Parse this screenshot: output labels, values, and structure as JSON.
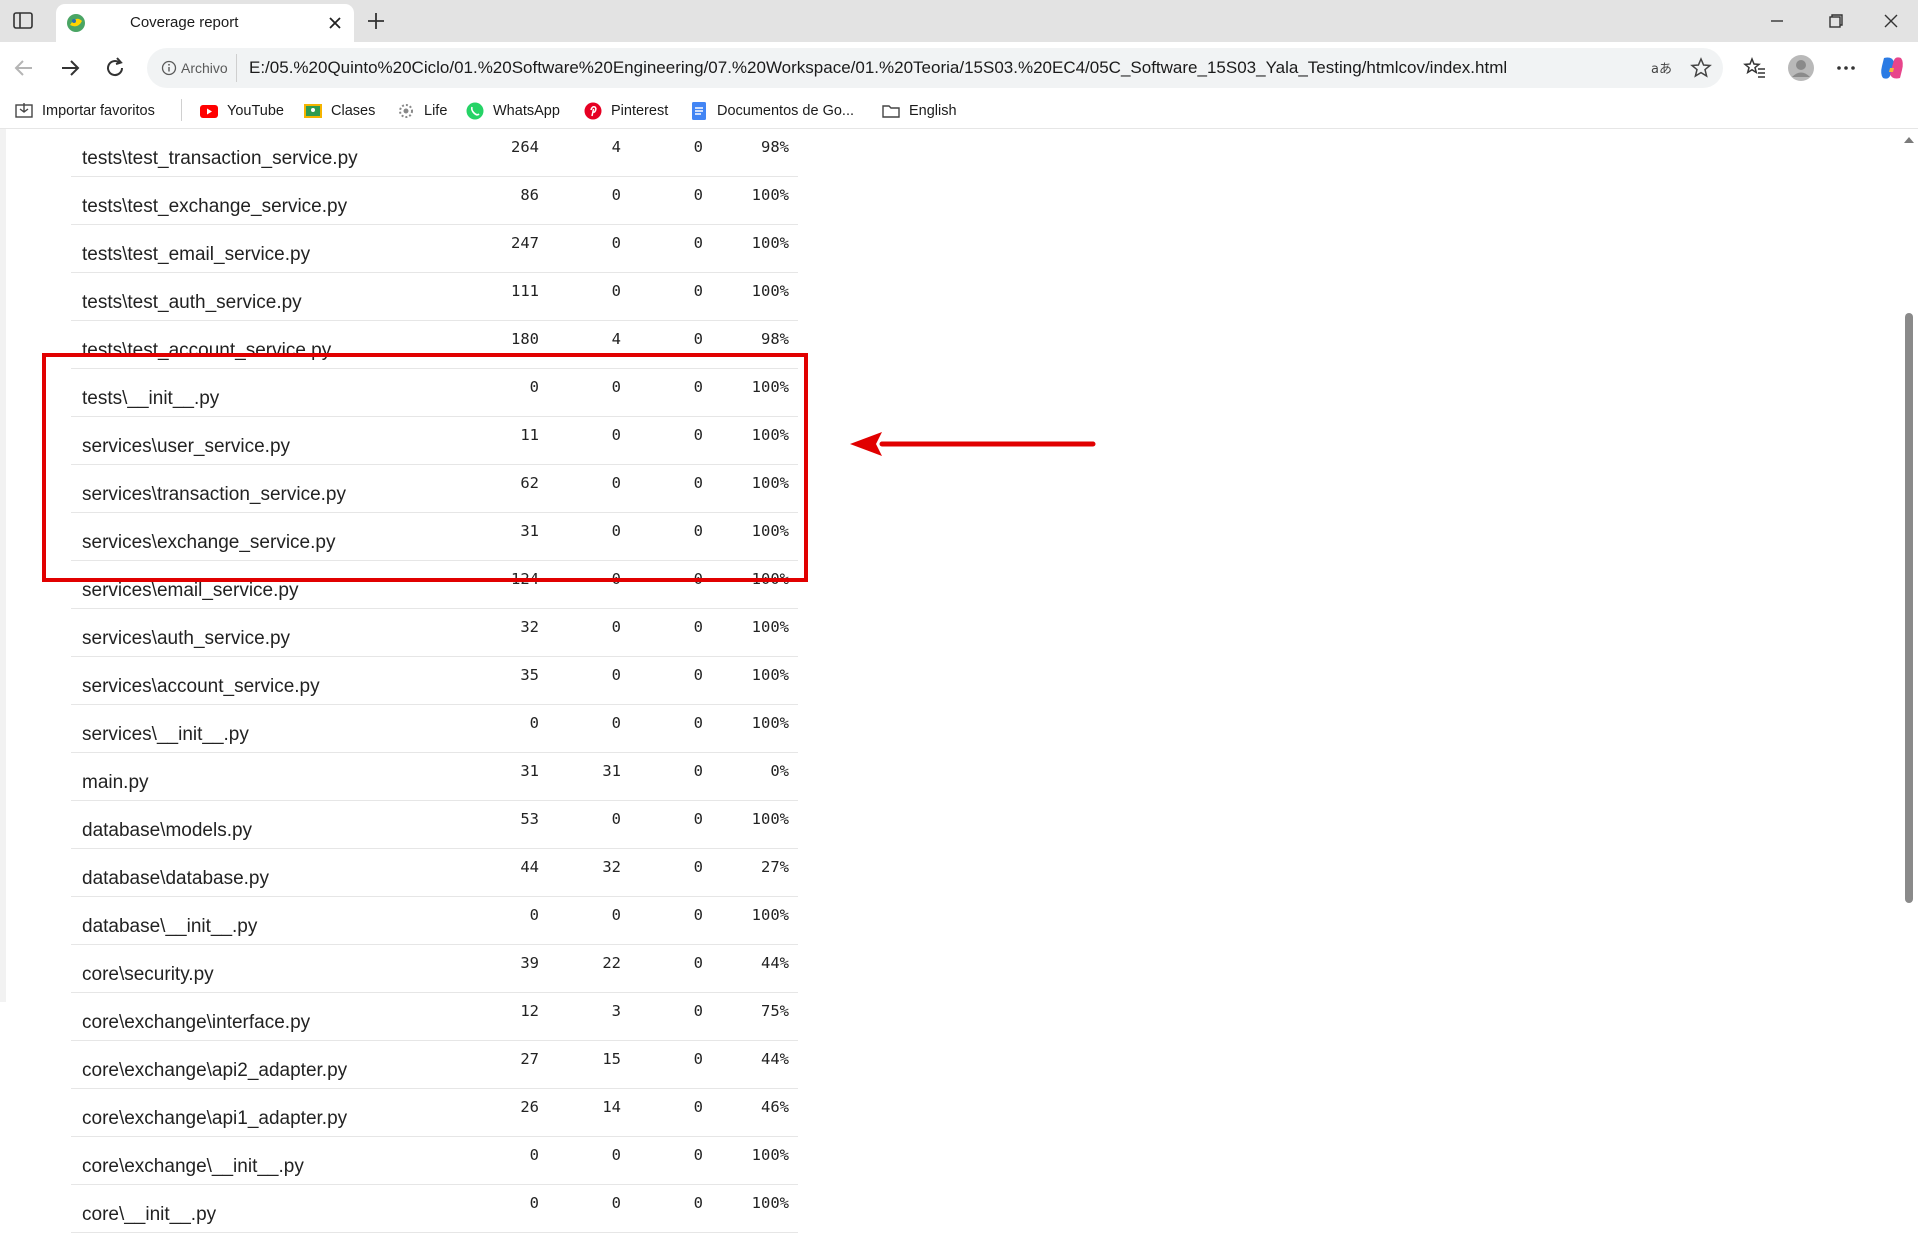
{
  "tab": {
    "title": "Coverage report"
  },
  "toolbar": {
    "security_chip": "Archivo",
    "url": "E:/05.%20Quinto%20Ciclo/01.%20Software%20Engineering/07.%20Workspace/01.%20Teoria/15S03.%20EC4/05C_Software_15S03_Yala_Testing/htmlcov/index.html"
  },
  "favorites": [
    {
      "label": "Importar favoritos",
      "icon": "import-icon"
    },
    {
      "label": "YouTube",
      "icon": "youtube-icon"
    },
    {
      "label": "Clases",
      "icon": "classroom-icon"
    },
    {
      "label": "Life",
      "icon": "life-icon"
    },
    {
      "label": "WhatsApp",
      "icon": "whatsapp-icon"
    },
    {
      "label": "Pinterest",
      "icon": "pinterest-icon"
    },
    {
      "label": "Documentos de Go...",
      "icon": "docs-icon"
    },
    {
      "label": "English",
      "icon": "folder-icon"
    }
  ],
  "rows": [
    [
      "tests\\test_transaction_service.py",
      "264",
      "4",
      "0",
      "98%"
    ],
    [
      "tests\\test_exchange_service.py",
      "86",
      "0",
      "0",
      "100%"
    ],
    [
      "tests\\test_email_service.py",
      "247",
      "0",
      "0",
      "100%"
    ],
    [
      "tests\\test_auth_service.py",
      "111",
      "0",
      "0",
      "100%"
    ],
    [
      "tests\\test_account_service.py",
      "180",
      "4",
      "0",
      "98%"
    ],
    [
      "tests\\__init__.py",
      "0",
      "0",
      "0",
      "100%"
    ],
    [
      "services\\user_service.py",
      "11",
      "0",
      "0",
      "100%"
    ],
    [
      "services\\transaction_service.py",
      "62",
      "0",
      "0",
      "100%"
    ],
    [
      "services\\exchange_service.py",
      "31",
      "0",
      "0",
      "100%"
    ],
    [
      "services\\email_service.py",
      "124",
      "0",
      "0",
      "100%"
    ],
    [
      "services\\auth_service.py",
      "32",
      "0",
      "0",
      "100%"
    ],
    [
      "services\\account_service.py",
      "35",
      "0",
      "0",
      "100%"
    ],
    [
      "services\\__init__.py",
      "0",
      "0",
      "0",
      "100%"
    ],
    [
      "main.py",
      "31",
      "31",
      "0",
      "0%"
    ],
    [
      "database\\models.py",
      "53",
      "0",
      "0",
      "100%"
    ],
    [
      "database\\database.py",
      "44",
      "32",
      "0",
      "27%"
    ],
    [
      "database\\__init__.py",
      "0",
      "0",
      "0",
      "100%"
    ],
    [
      "core\\security.py",
      "39",
      "22",
      "0",
      "44%"
    ],
    [
      "core\\exchange\\interface.py",
      "12",
      "3",
      "0",
      "75%"
    ],
    [
      "core\\exchange\\api2_adapter.py",
      "27",
      "15",
      "0",
      "44%"
    ],
    [
      "core\\exchange\\api1_adapter.py",
      "26",
      "14",
      "0",
      "46%"
    ],
    [
      "core\\exchange\\__init__.py",
      "0",
      "0",
      "0",
      "100%"
    ],
    [
      "core\\__init__.py",
      "0",
      "0",
      "0",
      "100%"
    ]
  ],
  "annotation_color": "#e10000"
}
